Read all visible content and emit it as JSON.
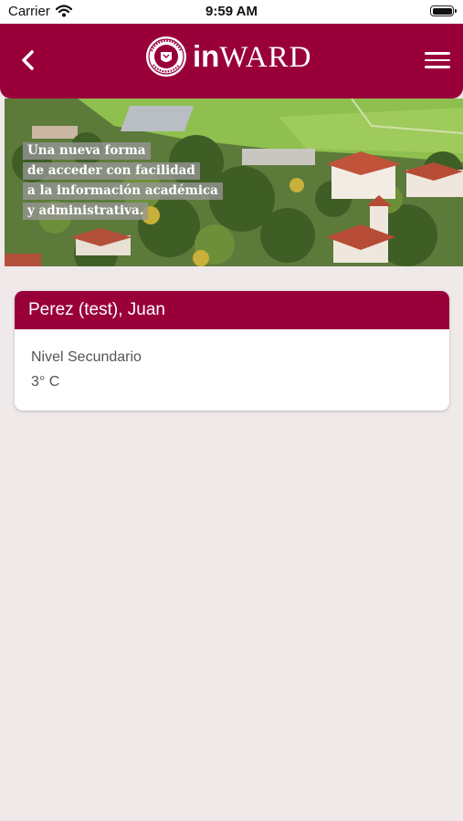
{
  "status_bar": {
    "carrier": "Carrier",
    "time": "9:59 AM"
  },
  "header": {
    "logo_text_in": "in",
    "logo_text_ward": "WARD",
    "seal_lettering": "COLEGIO WARD",
    "brand_color": "#99003a"
  },
  "hero": {
    "lines": [
      "Una nueva forma",
      "de acceder con facilidad",
      "a la información académica",
      "y administrativa."
    ]
  },
  "student_card": {
    "name": "Perez (test), Juan",
    "level": "Nivel Secundario",
    "grade": "3° C"
  },
  "icons": [
    "wifi-icon",
    "battery-icon",
    "back-chevron-icon",
    "hamburger-menu-icon",
    "school-seal-logo"
  ]
}
